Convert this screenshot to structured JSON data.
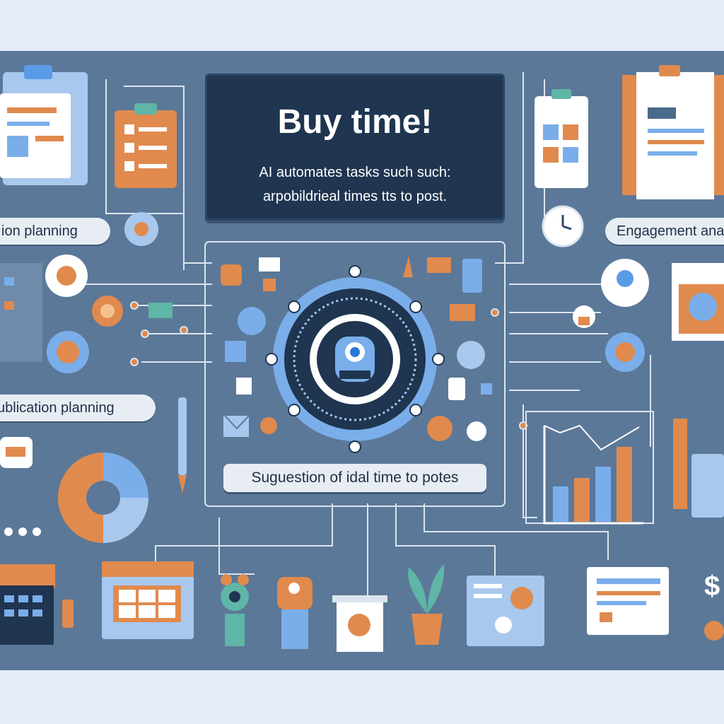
{
  "header": {
    "title": "Buy time!",
    "subtitle_line1": "AI automates tasks such such:",
    "subtitle_line2": "arpobildrieal times tts to post."
  },
  "labels": {
    "top_left": "ion planning",
    "mid_left": "ublication planning",
    "top_right": "Engagement ana",
    "center": "Suguestion of idal time to potes"
  },
  "colors": {
    "background": "#e4ecf6",
    "panel": "#5b7898",
    "title_box": "#1f3550",
    "accent_orange": "#e08a4e",
    "accent_blue": "#7aaeea",
    "line": "#dce5ef"
  },
  "icons": [
    "clipboard-icon",
    "document-icon",
    "gear-icon",
    "clock-icon",
    "envelope-icon",
    "lock-icon",
    "robot-icon",
    "bar-chart-icon",
    "pie-chart-icon",
    "calendar-icon",
    "keyboard-icon",
    "plant-icon",
    "monitor-icon",
    "dollar-icon",
    "pen-icon"
  ]
}
